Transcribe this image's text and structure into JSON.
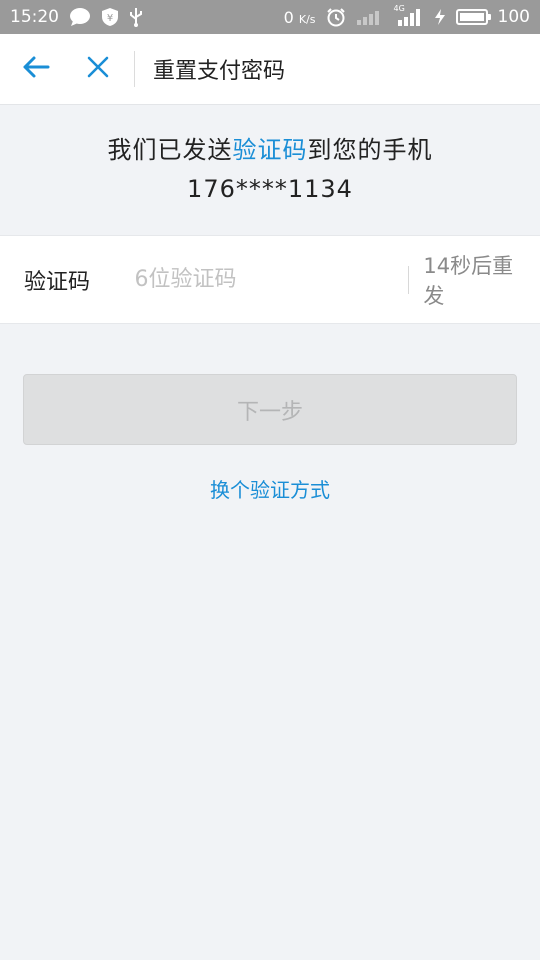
{
  "status_bar": {
    "time": "15:20",
    "net_speed": "0",
    "net_speed_unit": "K/s",
    "signal_label": "4G",
    "battery": "100"
  },
  "app_bar": {
    "title": "重置支付密码"
  },
  "notice": {
    "prefix": "我们已发送",
    "highlight": "验证码",
    "suffix": "到您的手机",
    "phone": "176****1134"
  },
  "code_field": {
    "label": "验证码",
    "placeholder": "6位验证码",
    "value": "",
    "resend_text": "14秒后重发"
  },
  "next_button": {
    "label": "下一步"
  },
  "switch_link": {
    "label": "换个验证方式"
  },
  "colors": {
    "accent": "#1a8ed6",
    "background": "#f1f3f6",
    "disabled_button": "#dedfe0"
  }
}
